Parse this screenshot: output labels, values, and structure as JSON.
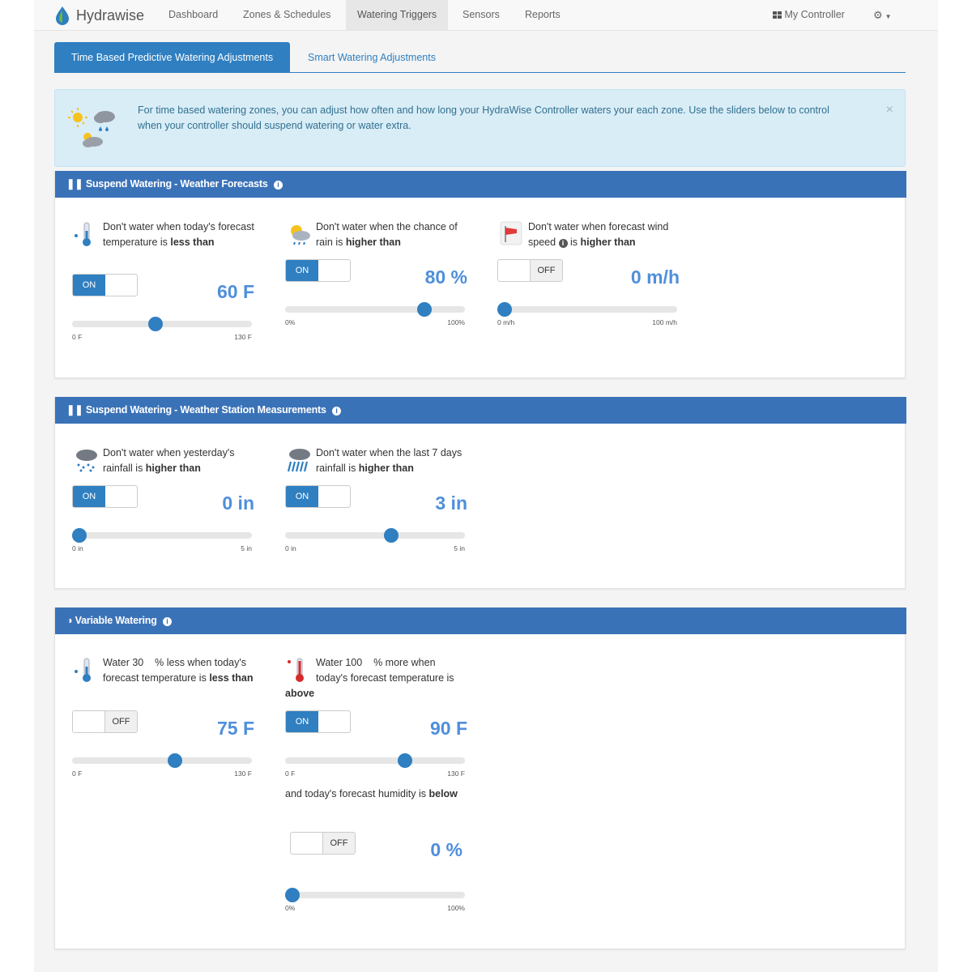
{
  "nav": {
    "brand": "Hydrawise",
    "items": [
      "Dashboard",
      "Zones & Schedules",
      "Watering Triggers",
      "Sensors",
      "Reports"
    ],
    "controller": "My Controller"
  },
  "tabs": {
    "active": "Time Based Predictive Watering Adjustments",
    "inactive": "Smart Watering Adjustments"
  },
  "alert": {
    "text": "For time based watering zones, you can adjust how often and how long your HydraWise Controller waters your each zone. Use the sliders below to control when your controller should suspend watering or water extra.",
    "close": "×"
  },
  "panels": {
    "forecast": {
      "title": "Suspend Watering - Weather Forecasts"
    },
    "station": {
      "title": "Suspend Watering - Weather Station Measurements"
    },
    "variable": {
      "title": "Variable Watering"
    }
  },
  "controls": {
    "temp": {
      "pre": "Don't water when today's forecast temperature is ",
      "bold": "less than",
      "toggle": "ON",
      "value": "60 F",
      "min": "0 F",
      "max": "130 F",
      "level": 0.46
    },
    "rain": {
      "pre": "Don't water when the chance of rain is ",
      "bold": "higher than",
      "toggle": "ON",
      "value": "80 %",
      "min": "0%",
      "max": "100%",
      "level": 0.8
    },
    "wind": {
      "pre": "Don't water when forecast wind speed ",
      "mid": " is ",
      "bold": "higher than",
      "toggle": "OFF",
      "value": "0 m/h",
      "min": "0 m/h",
      "max": "100 m/h",
      "level": 0.0
    },
    "yesterday": {
      "pre": "Don't water when yesterday's rainfall is ",
      "bold": "higher than",
      "toggle": "ON",
      "value": "0 in",
      "min": "0 in",
      "max": "5 in",
      "level": 0.0
    },
    "last7": {
      "pre": "Don't water when the last 7 days rainfall is ",
      "bold": "higher than",
      "toggle": "ON",
      "value": "3 in",
      "min": "0 in",
      "max": "5 in",
      "level": 0.6
    },
    "waterLess": {
      "pre": "Water 30    % less when today's forecast temperature is ",
      "bold": "less than",
      "toggle": "OFF",
      "value": "75 F",
      "min": "0 F",
      "max": "130 F",
      "level": 0.58
    },
    "waterMore": {
      "pre": "Water 100    % more when today's forecast temperature is ",
      "bold": "above",
      "toggle": "ON",
      "value": "90 F",
      "min": "0 F",
      "max": "130 F",
      "level": 0.68
    },
    "humidity": {
      "pre": "and today's forecast humidity is ",
      "bold": "below",
      "toggle": "OFF",
      "value": "0 %",
      "min": "0%",
      "max": "100%",
      "level": 0.0
    }
  }
}
